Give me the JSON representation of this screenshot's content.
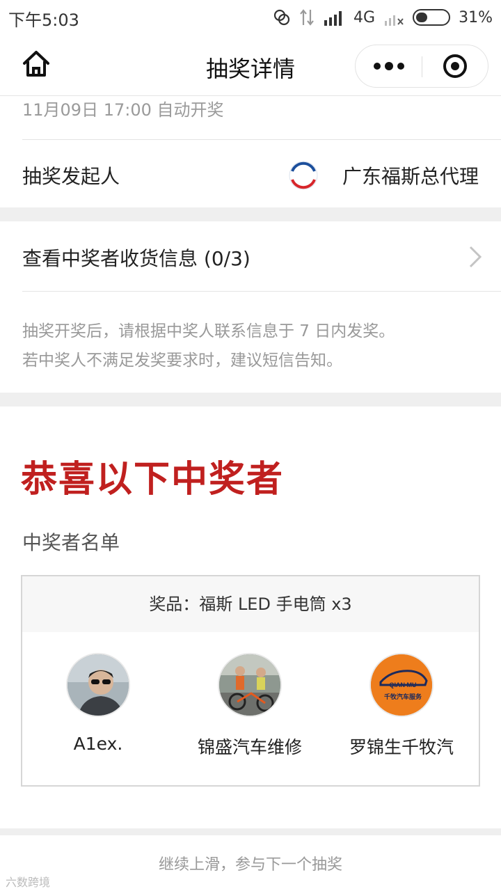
{
  "status_bar": {
    "time": "下午5:03",
    "network": "4G",
    "battery": "31%"
  },
  "nav": {
    "title": "抽奖详情"
  },
  "draw": {
    "time_text": "11月09日 17:00 自动开奖"
  },
  "organizer": {
    "label": "抽奖发起人",
    "name": "广东福斯总代理",
    "logo_text": "FUCHS"
  },
  "shipping": {
    "label": "查看中奖者收货信息 (0/3)",
    "tip_line1": "抽奖开奖后，请根据中奖人联系信息于 7 日内发奖。",
    "tip_line2": "若中奖人不满足发奖要求时，建议短信告知。"
  },
  "winners_section": {
    "congrats": "恭喜以下中奖者",
    "list_title": "中奖者名单",
    "prize": "奖品：福斯 LED 手电筒 x3",
    "winners": [
      {
        "name": "A1ex.⁣"
      },
      {
        "name": "锦盛汽车维修"
      },
      {
        "name": "罗锦生千牧汽",
        "logo_top": "QIAN MU",
        "logo_bottom": "千牧汽车服务"
      }
    ]
  },
  "footer": {
    "text": "继续上滑，参与下一个抽奖"
  },
  "watermark": {
    "text": "六数跨境"
  },
  "colors": {
    "accent_red": "#c0201f",
    "text_gray": "#999999"
  }
}
